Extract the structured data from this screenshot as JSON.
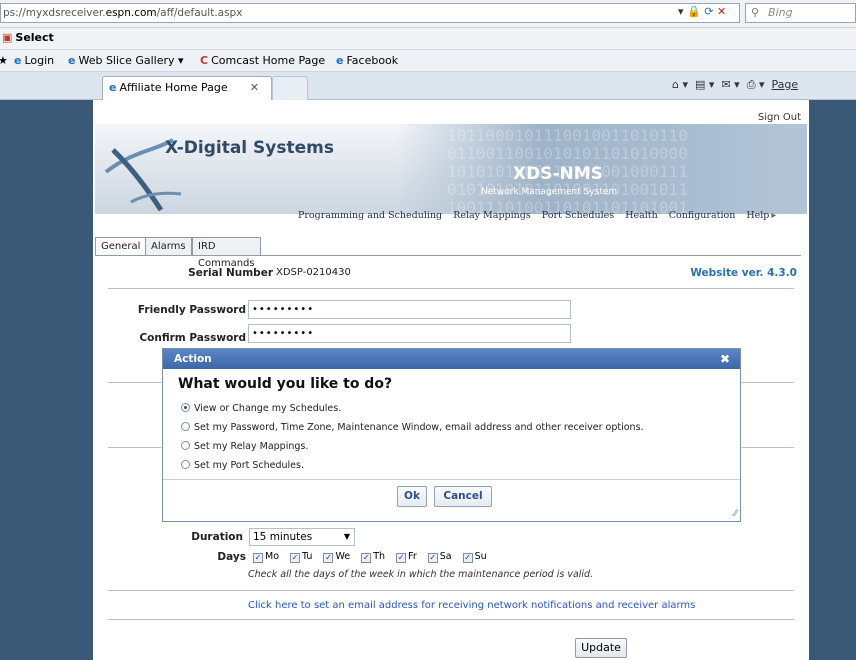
{
  "browser": {
    "url_prefix": "ps://myxdsreceiver.",
    "url_domain": "espn.com",
    "url_path": "/aff/default.aspx",
    "search_placeholder": "Bing",
    "menu_select": "Select",
    "favorites": [
      {
        "label": "Login",
        "icon": "ie-icon"
      },
      {
        "label": "Web Slice Gallery ▾",
        "icon": "ie-icon"
      },
      {
        "label": "Comcast Home Page",
        "icon": "comcast-icon"
      },
      {
        "label": "Facebook",
        "icon": "ie-icon"
      }
    ],
    "tab_title": "Affiliate Home Page",
    "tools_page": "Page"
  },
  "header": {
    "sign_out": "Sign Out",
    "company": "X-Digital Systems",
    "product": "XDS-NMS",
    "product_sub": "Network Management System",
    "binary_lines": [
      "1011000101110010011010110",
      "0110011001010101101010000",
      "1010101000110101001000111",
      "0101010101101001101001011",
      "1001110100110101101101001"
    ]
  },
  "nav": {
    "items": [
      "Programming and Scheduling",
      "Relay Mappings",
      "Port Schedules",
      "Health",
      "Configuration",
      "Help"
    ]
  },
  "tabs": [
    "General",
    "Alarms",
    "IRD Commands"
  ],
  "form": {
    "serial_label": "Serial Number",
    "serial_value": "XDSP-0210430",
    "website_version": "Website ver. 4.3.0",
    "friendly_password_label": "Friendly Password",
    "friendly_password_value": "•••••••••",
    "confirm_password_label": "Confirm Password",
    "confirm_password_value": "•••••••••",
    "duration_label": "Duration",
    "duration_value": "15 minutes",
    "days_label": "Days",
    "days": [
      {
        "label": "Mo",
        "checked": true
      },
      {
        "label": "Tu",
        "checked": true
      },
      {
        "label": "We",
        "checked": true
      },
      {
        "label": "Th",
        "checked": true
      },
      {
        "label": "Fr",
        "checked": true
      },
      {
        "label": "Sa",
        "checked": true
      },
      {
        "label": "Su",
        "checked": true
      }
    ],
    "days_help": "Check all the days of the week in which the maintenance period is valid.",
    "email_link": "Click here to set an email address for receiving network notifications and receiver alarms",
    "update_button": "Update"
  },
  "dialog": {
    "title": "Action",
    "question": "What would you like to do?",
    "options": [
      {
        "label": "View or Change my Schedules.",
        "selected": true
      },
      {
        "label": "Set my Password, Time Zone, Maintenance Window, email address and other receiver options.",
        "selected": false
      },
      {
        "label": "Set my Relay Mappings.",
        "selected": false
      },
      {
        "label": "Set my Port Schedules.",
        "selected": false
      }
    ],
    "ok": "Ok",
    "cancel": "Cancel"
  },
  "colors": {
    "page_bg": "#3a5977",
    "dialog_title": "#4a74b6",
    "link": "#2a55c5",
    "version": "#2a6fb4"
  }
}
